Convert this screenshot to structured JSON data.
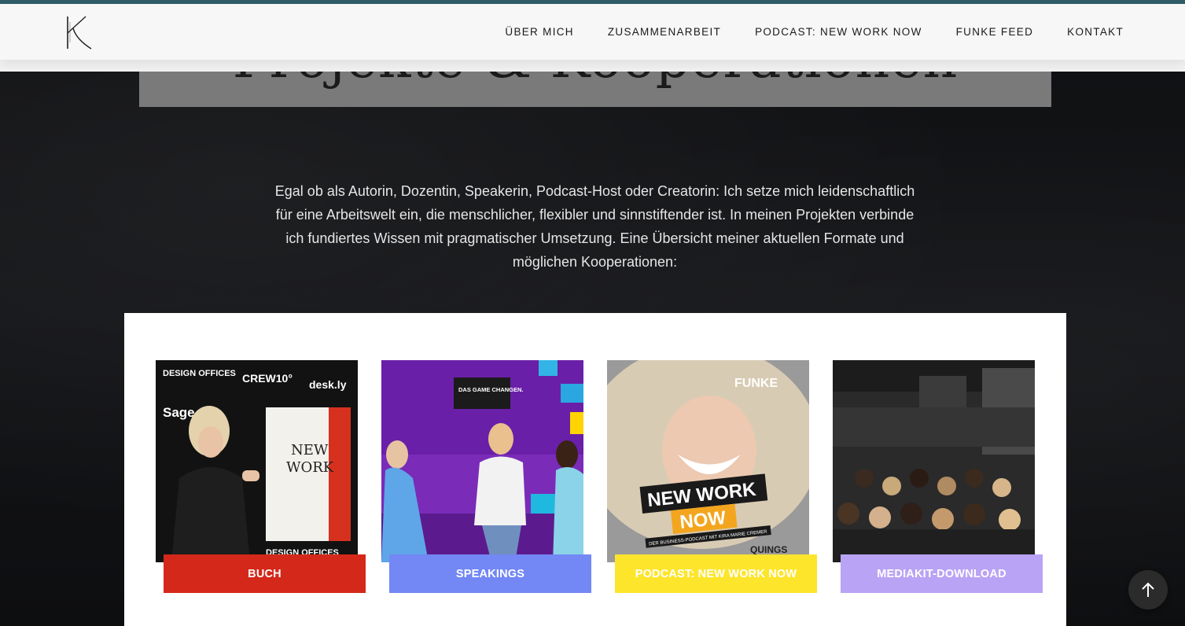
{
  "header": {
    "logo_icon": "kira-marie-cremer-k-monogram",
    "nav": [
      {
        "label": "ÜBER MICH"
      },
      {
        "label": "ZUSAMMENARBEIT"
      },
      {
        "label": "PODCAST: NEW WORK NOW"
      },
      {
        "label": "FUNKE FEED"
      },
      {
        "label": "KONTAKT"
      }
    ],
    "accent_line_color": "#2e5d67"
  },
  "hero": {
    "title": "Projekte & Kooperationen"
  },
  "intro": {
    "text": "Egal ob als Autorin, Dozentin, Speakerin, Podcast-Host oder Creatorin: Ich setze mich leidenschaftlich für eine Arbeitswelt ein, die menschlicher, flexibler und sinnstiftender ist. In meinen Projekten verbinde ich fundiertes Wissen mit pragmatischer Umsetzung. Eine Übersicht meiner aktuellen Formate und möglichen Kooperationen:"
  },
  "cards": [
    {
      "button": "BUCH",
      "button_color": "#d4281b",
      "button_text_color": "#ffffff",
      "image_texts": {
        "brand1": "DESIGN OFFICES",
        "brand2": "CREW10°",
        "brand3": "desk.ly",
        "brand4": "Sage",
        "book_line1": "NEW",
        "book_line2": "WORK",
        "footer": "DESIGN OFFICES"
      }
    },
    {
      "button": "SPEAKINGS",
      "button_color": "#7387f5",
      "button_text_color": "#ffffff",
      "image_texts": {
        "screen": "DAS GAME CHANGEN."
      }
    },
    {
      "button": "PODCAST: NEW WORK NOW",
      "button_color": "#fde52c",
      "button_text_color": "#ffffff",
      "image_texts": {
        "brand": "FUNKE",
        "line1": "NEW WORK",
        "line2": "NOW",
        "subtitle": "DER BUSINESS-PODCAST MIT KIRA MARIE CREMER",
        "sponsor": "QUINGS"
      }
    },
    {
      "button": "MEDIAKIT-DOWNLOAD",
      "button_color": "#b9a3f5",
      "button_text_color": "#ffffff",
      "image_texts": {}
    }
  ],
  "scroll_top": {
    "icon": "arrow-up-icon"
  }
}
